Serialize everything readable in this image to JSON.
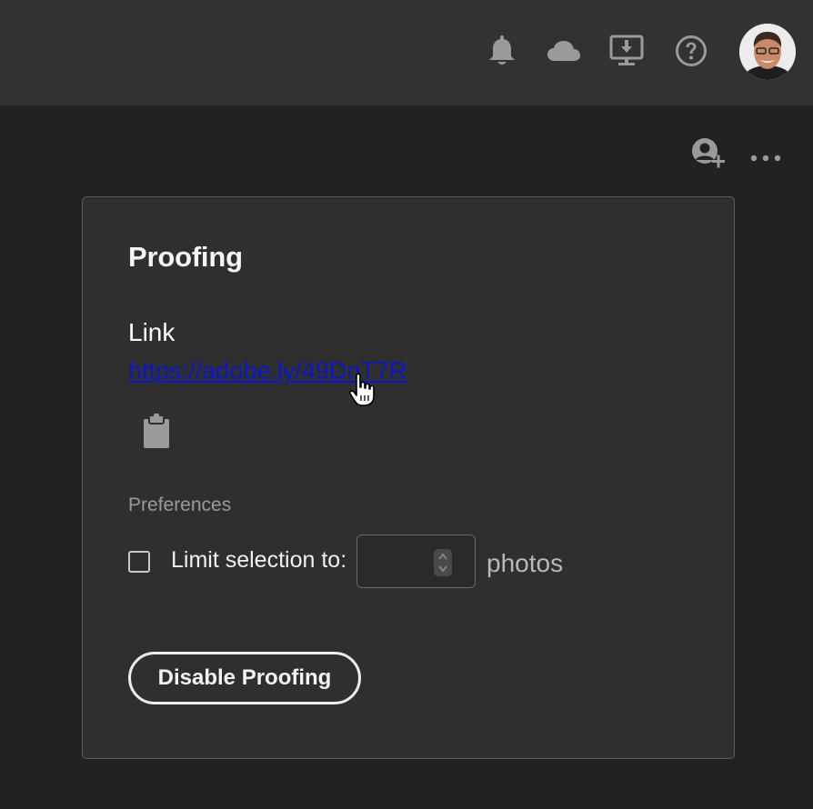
{
  "topbar": {
    "icons": [
      "bell-icon",
      "cloud-icon",
      "download-display-icon",
      "help-icon"
    ],
    "avatar": "avatar"
  },
  "toolbar": {
    "icons": [
      "add-person-icon",
      "more-icon"
    ]
  },
  "panel": {
    "title": "Proofing",
    "link_label": "Link",
    "link_url": "https://adobe.ly/49DnT7R",
    "copy_icon": "clipboard-icon",
    "preferences_label": "Preferences",
    "limit_checkbox_checked": false,
    "limit_label": "Limit selection to:",
    "limit_value": "",
    "photos_label": "photos",
    "disable_button_label": "Disable Proofing"
  },
  "colors": {
    "background": "#222222",
    "topbar": "#323232",
    "panel": "#2f2f2f",
    "link": "#0a16cc"
  }
}
